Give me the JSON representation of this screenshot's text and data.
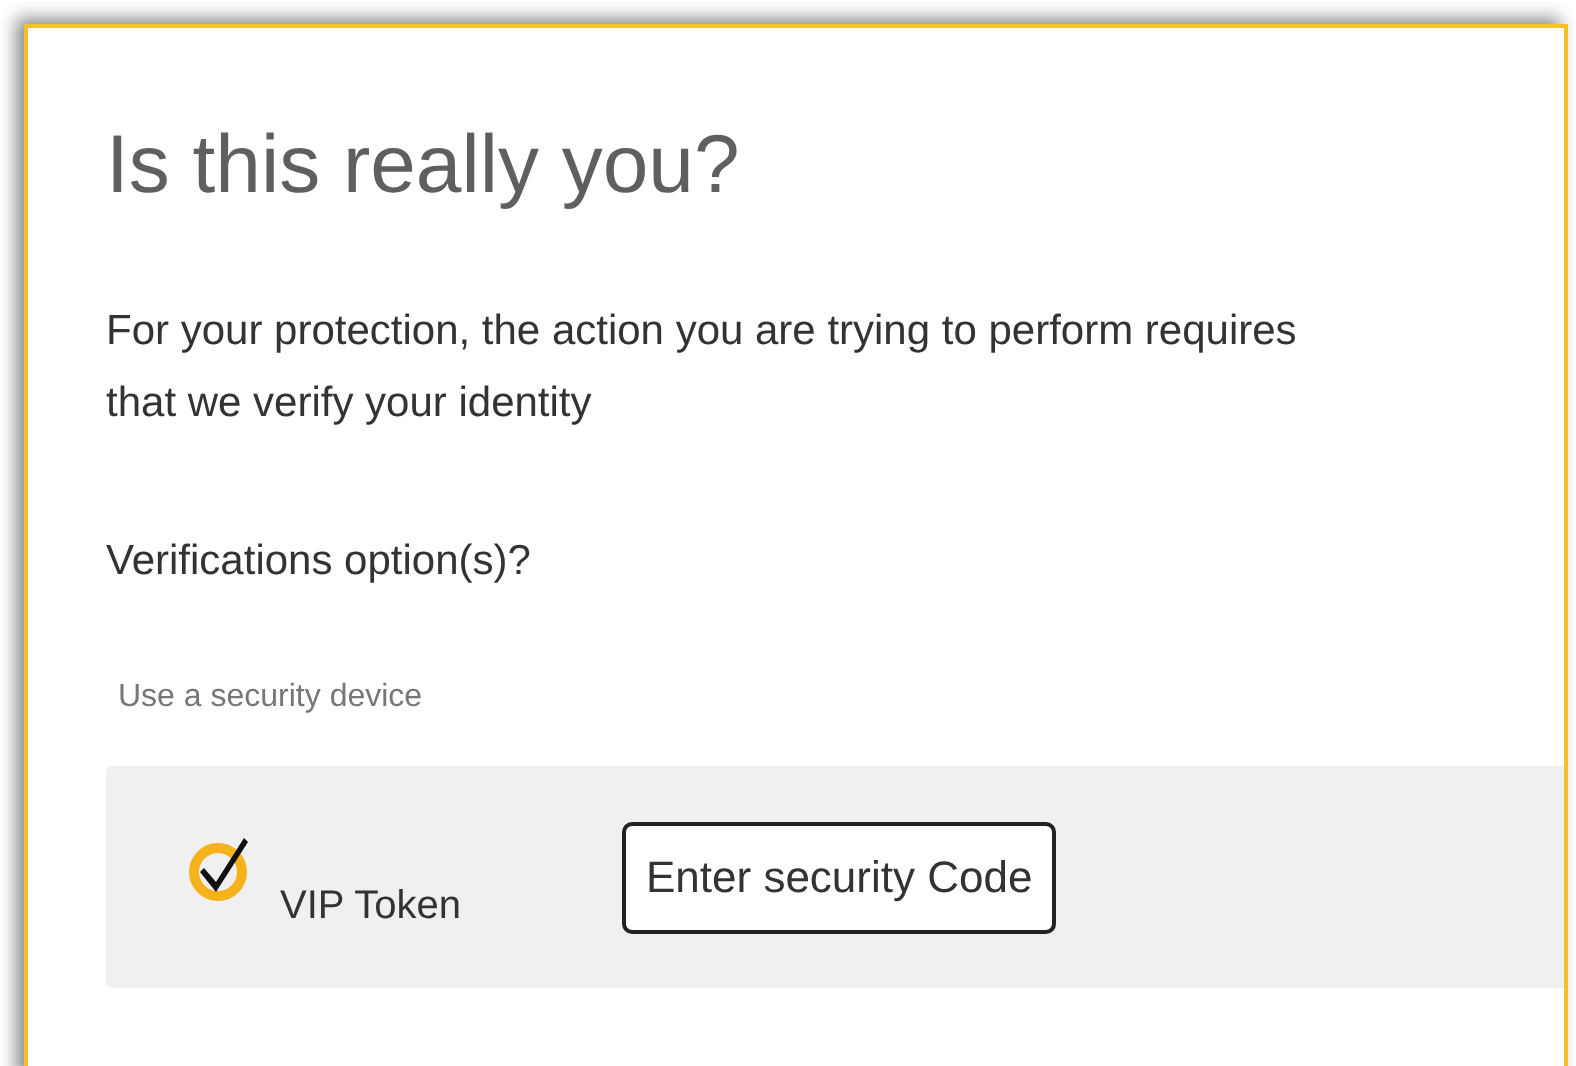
{
  "title": "Is this really you?",
  "description": "For your protection, the action you are trying to perform requires that we verify your identity",
  "options_label": "Verifications option(s)?",
  "section_label": "Use a security device",
  "devices": [
    {
      "name": "VIP Token",
      "button": "Enter security Code"
    }
  ]
}
